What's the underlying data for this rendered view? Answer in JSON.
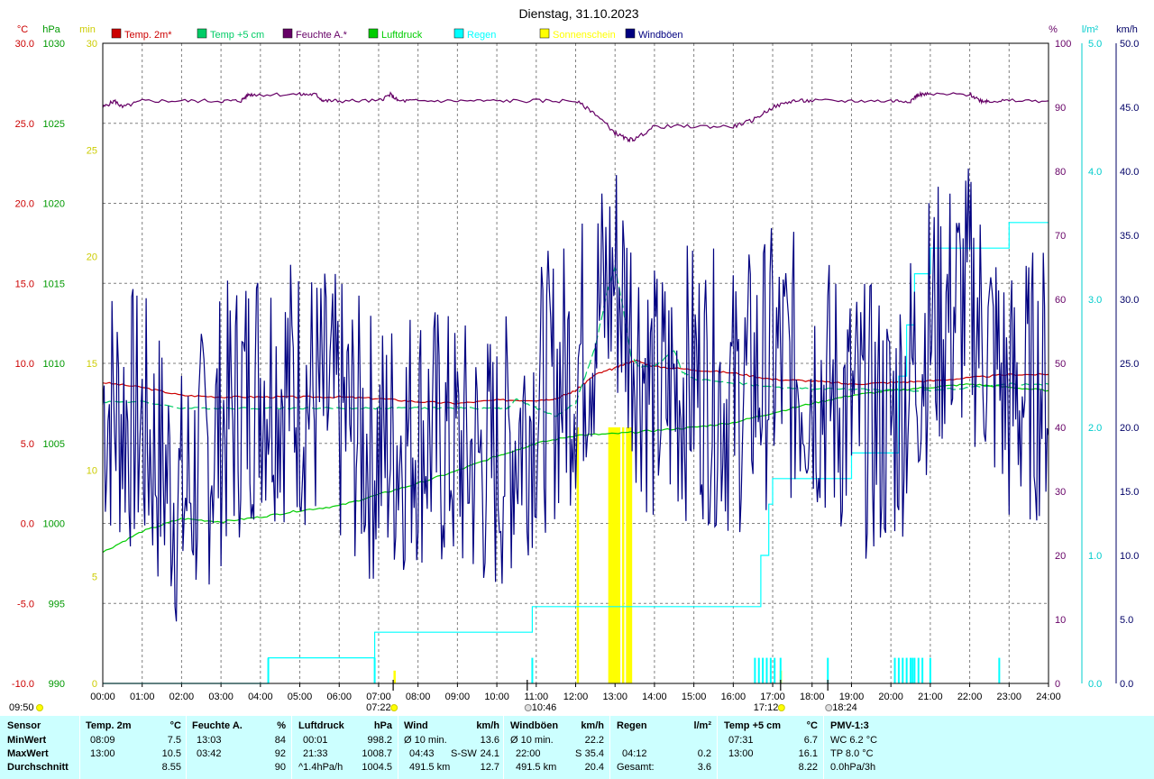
{
  "chart_data": {
    "type": "line",
    "title": "Dienstag, 31.10.2023",
    "x_ticks": [
      "00:00",
      "01:00",
      "02:00",
      "03:00",
      "04:00",
      "05:00",
      "06:00",
      "07:00",
      "08:00",
      "09:00",
      "10:00",
      "11:00",
      "12:00",
      "13:00",
      "14:00",
      "15:00",
      "16:00",
      "17:00",
      "18:00",
      "19:00",
      "20:00",
      "21:00",
      "22:00",
      "23:00",
      "24:00"
    ],
    "axes": {
      "temp": {
        "unit": "°C",
        "color": "#cc0000",
        "min": -10,
        "max": 30,
        "ticks": [
          "-10.0",
          "-5.0",
          "0.0",
          "5.0",
          "10.0",
          "15.0",
          "20.0",
          "25.0",
          "30.0"
        ]
      },
      "pressure": {
        "unit": "hPa",
        "color": "#009900",
        "min": 990,
        "max": 1030,
        "ticks": [
          "990",
          "995",
          "1000",
          "1005",
          "1010",
          "1015",
          "1020",
          "1025",
          "1030"
        ]
      },
      "sunshine": {
        "unit": "min",
        "color": "#cccc00",
        "min": 0,
        "max": 30,
        "ticks": [
          "0",
          "5",
          "10",
          "15",
          "20",
          "25",
          "30"
        ]
      },
      "humidity": {
        "unit": "%",
        "color": "#660066",
        "min": 0,
        "max": 100,
        "ticks": [
          "0",
          "10",
          "20",
          "30",
          "40",
          "50",
          "60",
          "70",
          "80",
          "90",
          "100"
        ]
      },
      "rain": {
        "unit": "l/m²",
        "color": "#00cccc",
        "min": 0,
        "max": 5,
        "ticks": [
          "0.0",
          "1.0",
          "2.0",
          "3.0",
          "4.0",
          "5.0"
        ]
      },
      "wind": {
        "unit": "km/h",
        "color": "#000066",
        "min": 0,
        "max": 50,
        "ticks": [
          "0.0",
          "5.0",
          "10.0",
          "15.0",
          "20.0",
          "25.0",
          "30.0",
          "35.0",
          "40.0",
          "45.0",
          "50.0"
        ]
      }
    },
    "legend": [
      {
        "name": "Temp. 2m*",
        "color": "#cc0000"
      },
      {
        "name": "Temp +5 cm",
        "color": "#00cc66"
      },
      {
        "name": "Feuchte A.*",
        "color": "#660066"
      },
      {
        "name": "Luftdruck",
        "color": "#00cc00"
      },
      {
        "name": "Regen",
        "color": "#00ffff"
      },
      {
        "name": "Sonnenschein",
        "color": "#ffff00"
      },
      {
        "name": "Windböen",
        "color": "#000080"
      }
    ],
    "series": [
      {
        "name": "Temp. 2m*",
        "axis": "temp",
        "color": "#cc0000",
        "x": [
          0,
          1,
          2,
          3,
          4,
          5,
          6,
          7,
          8,
          9,
          10,
          11,
          11.5,
          12,
          12.5,
          13,
          13.5,
          14,
          15,
          16,
          17,
          18,
          19,
          20,
          21,
          22,
          23,
          24
        ],
        "y": [
          8.8,
          8.5,
          8.0,
          7.9,
          7.9,
          7.9,
          7.9,
          7.8,
          7.6,
          7.5,
          7.7,
          7.7,
          7.8,
          8.3,
          9.3,
          9.7,
          10.2,
          9.8,
          9.6,
          9.4,
          9.0,
          8.9,
          8.7,
          8.8,
          8.9,
          9.1,
          9.3,
          9.3
        ]
      },
      {
        "name": "Temp +5 cm",
        "axis": "temp",
        "color": "#00cc66",
        "dashed": true,
        "x": [
          0,
          1,
          2,
          3,
          4,
          5,
          6,
          7,
          8,
          9,
          10,
          10.3,
          10.5,
          11,
          11.5,
          12,
          12.5,
          12.8,
          13,
          13.2,
          13.4,
          13.6,
          14,
          14.5,
          14.7,
          15,
          16,
          17,
          18,
          19,
          20,
          21,
          22,
          23,
          24
        ],
        "y": [
          7.6,
          7.6,
          7.2,
          7.2,
          7.2,
          7.2,
          7.2,
          7.2,
          7.2,
          7.2,
          7.2,
          7.2,
          7.8,
          7.2,
          6.7,
          7.5,
          11.0,
          14.5,
          16.0,
          13.5,
          10.5,
          9.8,
          9.8,
          10.8,
          9.5,
          9.0,
          8.8,
          8.5,
          8.4,
          8.4,
          8.3,
          8.3,
          8.5,
          8.7,
          8.7
        ]
      },
      {
        "name": "Feuchte A.*",
        "axis": "humidity",
        "color": "#660066",
        "x": [
          0,
          0.3,
          0.5,
          1,
          2,
          3,
          3.5,
          3.7,
          4,
          5,
          5.4,
          5.6,
          6,
          7,
          7.3,
          7.5,
          8,
          9,
          10,
          11,
          12,
          12.5,
          13,
          13.3,
          13.5,
          14,
          15,
          16,
          16.5,
          17,
          17.5,
          18,
          19,
          20,
          20.5,
          20.7,
          21,
          22,
          22.3,
          22.5,
          23,
          24
        ],
        "y": [
          90,
          91,
          90,
          91,
          91,
          91,
          91,
          92,
          92,
          92,
          92,
          91,
          91,
          91,
          92,
          91,
          91,
          91,
          91,
          91,
          91,
          89,
          86,
          85,
          85,
          87,
          87,
          87,
          88,
          90,
          91,
          91,
          91,
          91,
          91,
          92,
          92,
          92,
          91,
          91,
          91,
          91
        ]
      },
      {
        "name": "Luftdruck",
        "axis": "pressure",
        "color": "#00cc00",
        "x": [
          0,
          1,
          2,
          3,
          4,
          5,
          6,
          7,
          8,
          9,
          10,
          10.5,
          11,
          12,
          13,
          14,
          15,
          16,
          17,
          18,
          19,
          20,
          21,
          22,
          23,
          24
        ],
        "y": [
          998.2,
          999.5,
          1000.3,
          1000.1,
          1000.4,
          1000.8,
          1001.1,
          1001.8,
          1002.5,
          1003.3,
          1004.2,
          1004.6,
          1005.0,
          1005.5,
          1005.6,
          1005.8,
          1006.0,
          1006.3,
          1006.9,
          1007.5,
          1008.0,
          1008.3,
          1008.5,
          1008.7,
          1008.5,
          1008.3
        ]
      },
      {
        "name": "Regen",
        "axis": "rain",
        "color": "#00ffff",
        "step": true,
        "x": [
          0,
          4.2,
          6.9,
          10.9,
          16.5,
          16.7,
          16.9,
          17.0,
          18.4,
          19.0,
          20.0,
          20.2,
          20.4,
          20.6,
          21.0,
          21.5,
          22.0,
          22.7,
          23.0,
          24
        ],
        "y": [
          0,
          0.2,
          0.4,
          0.6,
          0.6,
          1.0,
          1.4,
          1.6,
          1.6,
          1.8,
          1.8,
          2.4,
          2.8,
          3.2,
          3.4,
          3.4,
          3.4,
          3.4,
          3.6,
          3.6
        ]
      },
      {
        "name": "Windböen",
        "axis": "wind",
        "color": "#000080",
        "fine": true,
        "x": [
          0,
          1,
          2,
          3,
          4,
          5,
          6,
          7,
          8,
          9,
          10,
          11,
          12,
          13,
          14,
          15,
          16,
          17,
          18,
          19,
          20,
          21,
          22,
          23,
          24
        ],
        "y": [
          22,
          20,
          14,
          20,
          24,
          23,
          21,
          18,
          20,
          18,
          17,
          22,
          25,
          32,
          22,
          24,
          22,
          25,
          24,
          21,
          20,
          28,
          30,
          22,
          24
        ]
      }
    ],
    "rain_bars": {
      "axis": "rain",
      "color": "#00ffff",
      "height": 0.2,
      "x": [
        4.2,
        6.9,
        10.9,
        16.55,
        16.65,
        16.75,
        16.85,
        16.95,
        17.05,
        17.2,
        18.4,
        20.1,
        20.2,
        20.3,
        20.4,
        20.5,
        20.55,
        20.6,
        20.7,
        20.8,
        21.0,
        22.75
      ]
    },
    "sun_bars": {
      "axis": "sunshine",
      "color": "#ffff00",
      "x": [
        7.4,
        12.05,
        12.85,
        12.9,
        12.95,
        13.0,
        13.05,
        13.1,
        13.2,
        13.3,
        13.35,
        13.4,
        17.2
      ],
      "y": [
        0.6,
        12,
        12,
        12,
        12,
        12,
        12,
        12,
        12,
        12,
        12,
        12,
        0.6
      ]
    },
    "markers": [
      {
        "label": "09:50",
        "x": -0.3,
        "kind": "sun"
      },
      {
        "label": "07:22",
        "x": 7.37,
        "kind": "sun"
      },
      {
        "label": "10:46",
        "x": 10.77,
        "kind": "moon"
      },
      {
        "label": "17:12",
        "x": 17.2,
        "kind": "sun"
      },
      {
        "label": "18:24",
        "x": 18.4,
        "kind": "moon"
      }
    ]
  },
  "stats": {
    "sensor": {
      "header": "Sensor",
      "rows": [
        "MinWert",
        "MaxWert",
        "Durchschnitt"
      ]
    },
    "temp2m": {
      "header": "Temp. 2m",
      "unit": "°C",
      "rows": [
        [
          "08:09",
          "7.5"
        ],
        [
          "13:00",
          "10.5"
        ],
        [
          "",
          "8.55"
        ]
      ]
    },
    "feuchte": {
      "header": "Feuchte A.",
      "unit": "%",
      "rows": [
        [
          "13:03",
          "84"
        ],
        [
          "03:42",
          "92"
        ],
        [
          "",
          "90"
        ]
      ]
    },
    "luftdruck": {
      "header": "Luftdruck",
      "unit": "hPa",
      "rows": [
        [
          "00:01",
          "998.2"
        ],
        [
          "21:33",
          "1008.7"
        ],
        [
          "^1.4hPa/h",
          "1004.5"
        ]
      ]
    },
    "wind": {
      "header": "Wind",
      "unit": "km/h",
      "rows": [
        [
          "Ø 10 min.",
          "",
          "13.6"
        ],
        [
          "04:43",
          "S-SW",
          "24.1"
        ],
        [
          "491.5 km",
          "",
          "12.7"
        ]
      ]
    },
    "windboeen": {
      "header": "Windböen",
      "unit": "km/h",
      "rows": [
        [
          "Ø 10 min.",
          "",
          "22.2"
        ],
        [
          "22:00",
          "S",
          "35.4"
        ],
        [
          "491.5 km",
          "",
          "20.4"
        ]
      ]
    },
    "regen": {
      "header": "Regen",
      "unit": "l/m²",
      "rows": [
        [
          "",
          ""
        ],
        [
          "04:12",
          "0.2"
        ],
        [
          "Gesamt:",
          "3.6"
        ]
      ]
    },
    "temp5": {
      "header": "Temp +5 cm",
      "unit": "°C",
      "rows": [
        [
          "07:31",
          "6.7"
        ],
        [
          "13:00",
          "16.1"
        ],
        [
          "",
          "8.22"
        ]
      ]
    },
    "pmv": {
      "header": "PMV-1:3",
      "rows": [
        "WC 6.2 °C",
        "TP 8.0 °C",
        "0.0hPa/3h"
      ]
    }
  }
}
